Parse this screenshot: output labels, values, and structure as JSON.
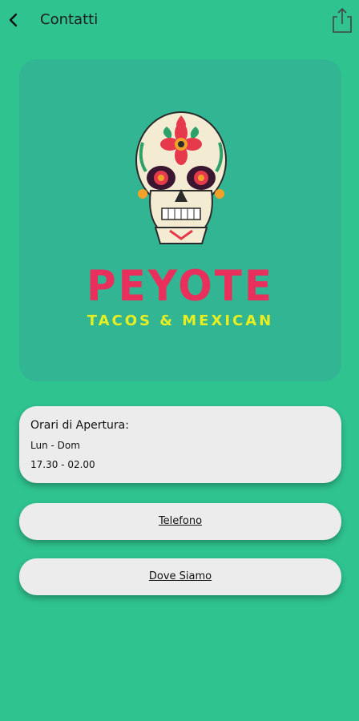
{
  "header": {
    "title": "Contatti",
    "back_icon": "chevron-left-icon",
    "share_icon": "share-icon"
  },
  "logo": {
    "brand": "PEYOTE",
    "tagline": "TACOS & MEXICAN",
    "colors": {
      "brand": "#e9305d",
      "tagline": "#e8ee1f",
      "card": "#31b593"
    }
  },
  "hours": {
    "title": "Orari di Apertura:",
    "days": "Lun - Dom",
    "time": "17.30 - 02.00"
  },
  "buttons": {
    "phone_label": "Telefono",
    "location_label": "Dove Siamo"
  },
  "colors": {
    "background": "#2fc38f",
    "card": "#ececec"
  }
}
